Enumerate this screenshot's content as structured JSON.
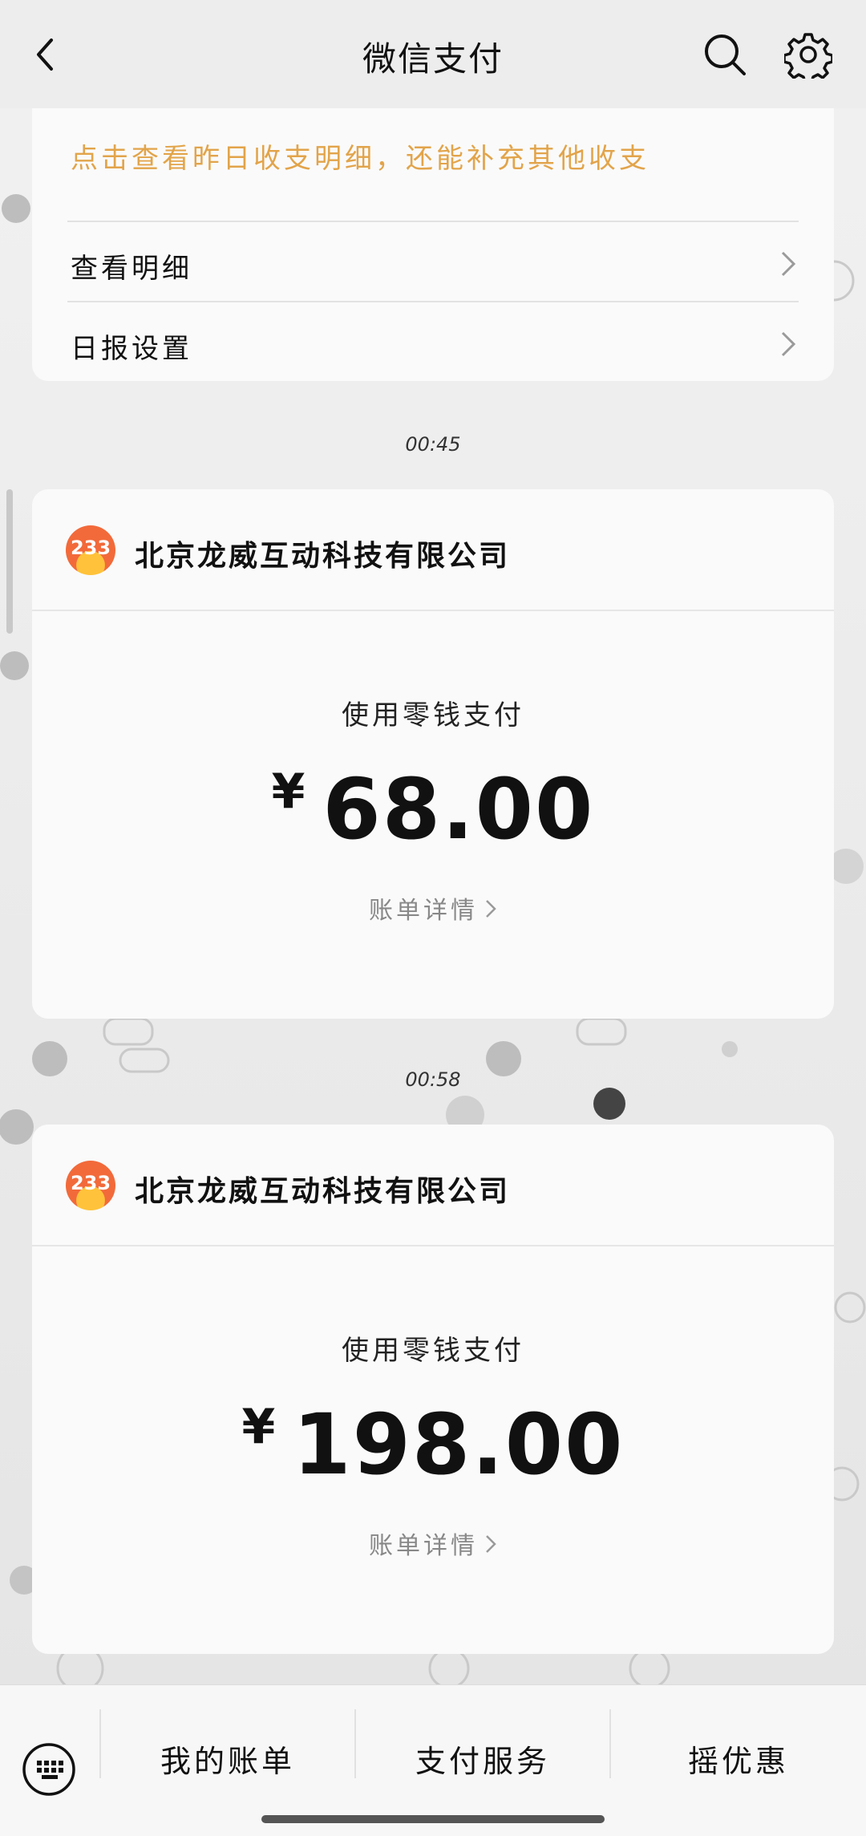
{
  "header": {
    "title": "微信支付",
    "back_icon": "chevron-left-icon",
    "search_icon": "search-icon",
    "settings_icon": "gear-icon"
  },
  "daily_report": {
    "message": "点击查看昨日收支明细，还能补充其他收支",
    "rows": [
      {
        "label": "查看明细"
      },
      {
        "label": "日报设置"
      }
    ]
  },
  "payments": [
    {
      "time": "00:45",
      "logo_text": "233",
      "merchant": "北京龙威互动科技有限公司",
      "method": "使用零钱支付",
      "currency": "¥",
      "amount": "68.00",
      "detail_link": "账单详情"
    },
    {
      "time": "00:58",
      "logo_text": "233",
      "merchant": "北京龙威互动科技有限公司",
      "method": "使用零钱支付",
      "currency": "¥",
      "amount": "198.00",
      "detail_link": "账单详情"
    }
  ],
  "bottom_bar": {
    "keyboard_icon": "keyboard-icon",
    "tabs": [
      {
        "label": "我的账单"
      },
      {
        "label": "支付服务"
      },
      {
        "label": "摇优惠"
      }
    ]
  },
  "colors": {
    "accent_text": "#e2a44a",
    "logo_orange": "#f26a3a",
    "logo_yellow": "#ffc23a"
  }
}
